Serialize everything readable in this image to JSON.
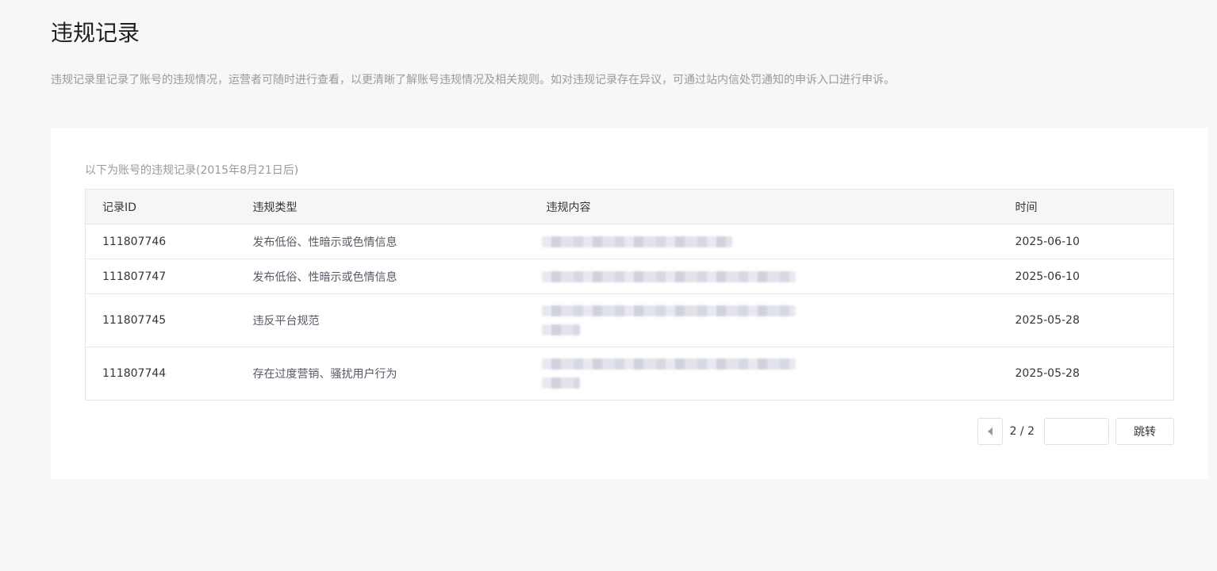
{
  "page": {
    "title": "违规记录",
    "description": "违规记录里记录了账号的违规情况，运营者可随时进行查看，以更清晰了解账号违规情况及相关规则。如对违规记录存在异议，可通过站内信处罚通知的申诉入口进行申诉。"
  },
  "records": {
    "caption": "以下为账号的违规记录(2015年8月21日后)",
    "columns": {
      "id": "记录ID",
      "type": "违规类型",
      "content": "违规内容",
      "time": "时间"
    },
    "rows": [
      {
        "id": "111807746",
        "type": "发布低俗、性暗示或色情信息",
        "time": "2025-06-10"
      },
      {
        "id": "111807747",
        "type": "发布低俗、性暗示或色情信息",
        "time": "2025-06-10"
      },
      {
        "id": "111807745",
        "type": "违反平台规范",
        "time": "2025-05-28"
      },
      {
        "id": "111807744",
        "type": "存在过度营销、骚扰用户行为",
        "time": "2025-05-28"
      }
    ]
  },
  "pagination": {
    "page_text": "2 / 2",
    "input_value": "",
    "jump_label": "跳转"
  },
  "icons": {
    "prev": "caret-left-icon"
  }
}
